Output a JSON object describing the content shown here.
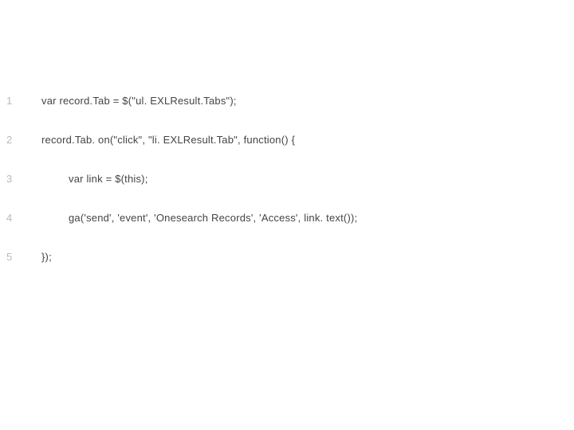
{
  "lines": [
    {
      "n": "1",
      "indent": 0,
      "text": "var record.Tab = $(\"ul. EXLResult.Tabs\");"
    },
    {
      "n": "2",
      "indent": 0,
      "text": "record.Tab. on(\"click\", \"li. EXLResult.Tab\", function() {"
    },
    {
      "n": "3",
      "indent": 1,
      "text": "var link = $(this);"
    },
    {
      "n": "4",
      "indent": 1,
      "text": "ga('send', 'event', 'Onesearch Records', 'Access', link. text());"
    },
    {
      "n": "5",
      "indent": 0,
      "text": "});"
    }
  ]
}
